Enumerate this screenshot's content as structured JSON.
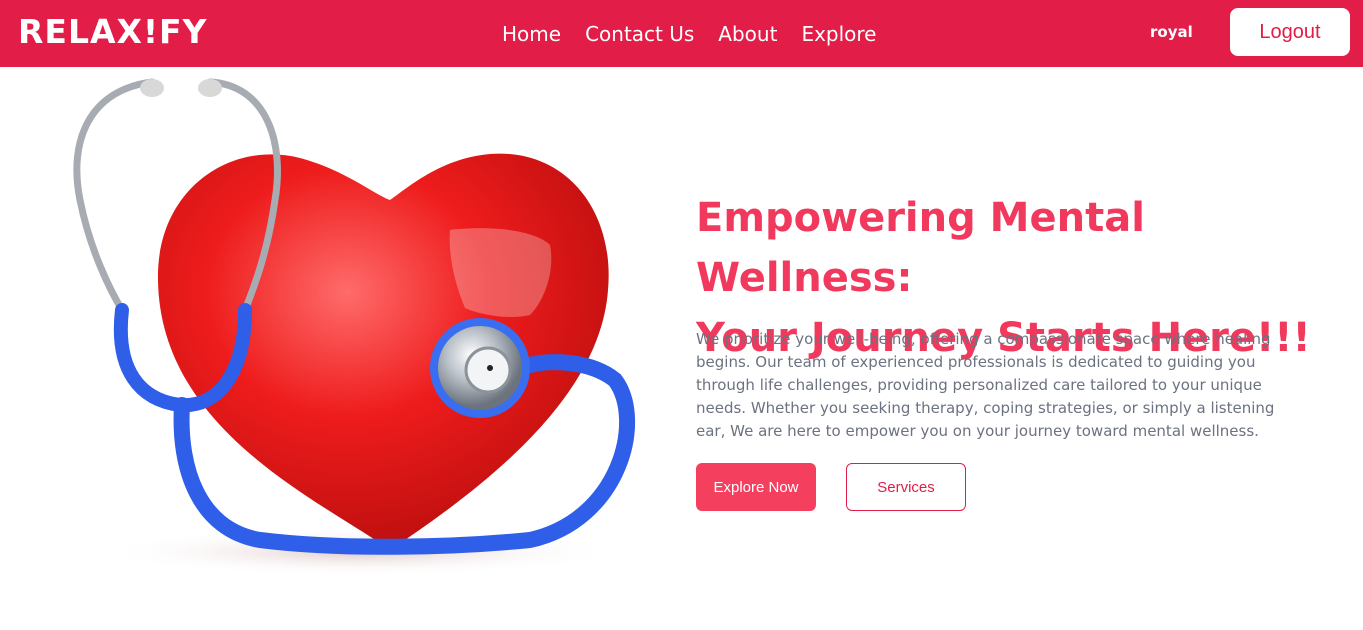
{
  "brand": {
    "logo_text": "RELAX!FY",
    "accent_color": "#e11d48"
  },
  "nav": {
    "links": [
      {
        "label": "Home"
      },
      {
        "label": "Contact Us"
      },
      {
        "label": "About"
      },
      {
        "label": "Explore"
      }
    ],
    "username": "royal",
    "logout_label": "Logout"
  },
  "hero": {
    "image_icon": "heart-stethoscope-illustration",
    "headline_line1": "Empowering Mental Wellness:",
    "headline_line2": "Your Journey Starts Here!!!",
    "description": "We prioritize your well-being, offering a compassionate space where healing begins. Our team of experienced professionals is dedicated to guiding you through life challenges, providing personalized care tailored to your unique needs. Whether you seeking therapy, coping strategies, or simply a listening ear, We are here to empower you on your journey toward mental wellness.",
    "primary_button_label": "Explore Now",
    "secondary_button_label": "Services"
  }
}
